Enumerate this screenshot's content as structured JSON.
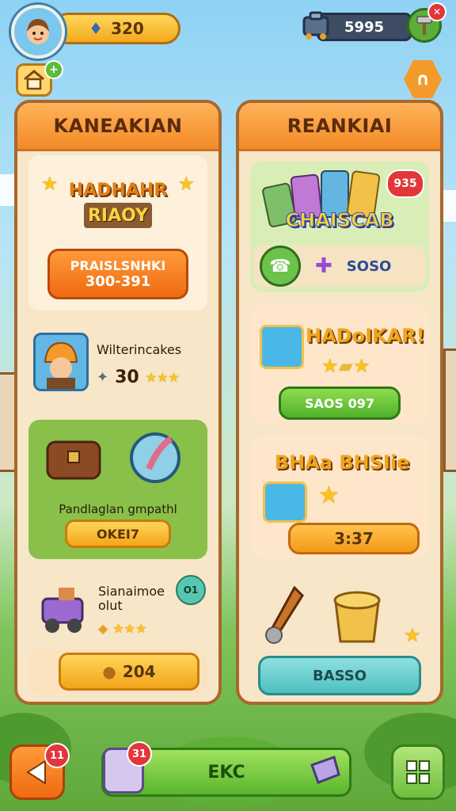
{
  "hud": {
    "coins": "320",
    "gears": "5995",
    "close_glyph": "✕",
    "plus_glyph": "+",
    "hex_glyph": "∩"
  },
  "left_panel": {
    "title": "KANEAKIAN",
    "featured": {
      "title": "HADHAHR",
      "subtitle": "RIAOY",
      "button_line1": "PRAISLSNHKI",
      "button_line2": "300-391"
    },
    "character": {
      "name": "Wilterincakes",
      "value": "30",
      "stars": "★★★"
    },
    "bundle": {
      "label": "Pandlaglan gmpathl",
      "button": "OKEI7"
    },
    "vehicle": {
      "line1": "Sianaimoe",
      "line2": "olut",
      "stars": "★★★",
      "badge": "O1"
    },
    "buy": {
      "value": "204"
    }
  },
  "right_panel": {
    "title": "REANKIAI",
    "cards_offer": {
      "title": "CHAISCAB",
      "price_badge": "935",
      "label": "SOSO"
    },
    "hero_reward": {
      "title": "HADoIKAR!",
      "button": "SAOS 097"
    },
    "bonus": {
      "title": "BHAa BHSIie",
      "button": "3:37"
    },
    "tools": {
      "button": "BASSO"
    }
  },
  "bottom": {
    "back_badge": "11",
    "main_label": "EKC",
    "main_badge": "31"
  },
  "colors": {
    "accent_orange": "#f38a27",
    "accent_green": "#5ab52e",
    "panel_bg": "#f7e6c7"
  }
}
